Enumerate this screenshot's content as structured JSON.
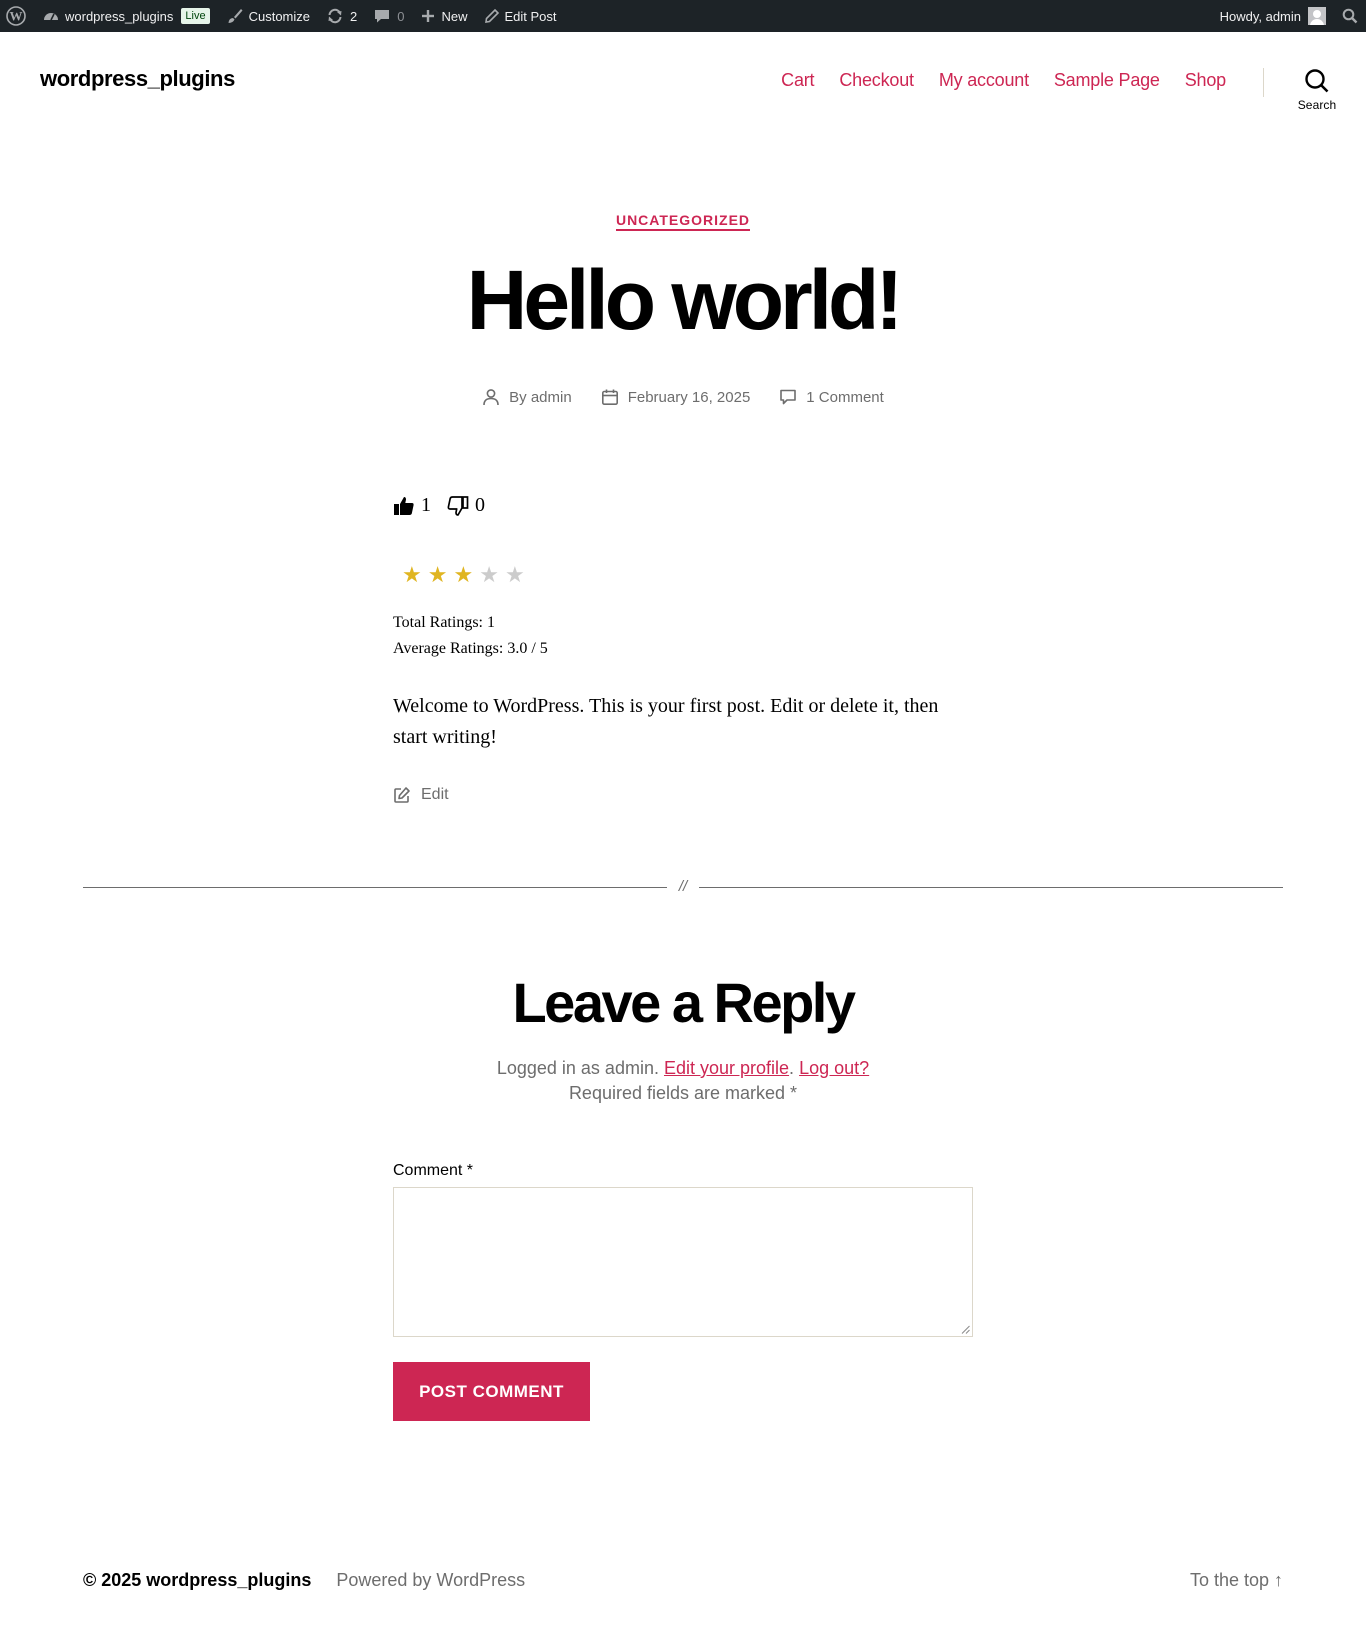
{
  "admin_bar": {
    "site_name": "wordpress_plugins",
    "live_badge": "Live",
    "customize": "Customize",
    "updates_count": "2",
    "comments_count": "0",
    "new_label": "New",
    "edit_post": "Edit Post",
    "howdy": "Howdy, admin"
  },
  "header": {
    "site_title": "wordpress_plugins",
    "nav": [
      "Cart",
      "Checkout",
      "My account",
      "Sample Page",
      "Shop"
    ],
    "search_label": "Search"
  },
  "post": {
    "category": "UNCATEGORIZED",
    "title": "Hello world!",
    "author": "By admin",
    "date": "February 16, 2025",
    "comments": "1 Comment",
    "likes": "1",
    "dislikes": "0",
    "rating": {
      "value": 3,
      "max": 5
    },
    "total_ratings": "Total Ratings: 1",
    "average_ratings": "Average Ratings: 3.0 / 5",
    "body": "Welcome to WordPress. This is your first post. Edit or delete it, then start writing!",
    "edit_label": "Edit",
    "separator": "//"
  },
  "reply": {
    "title": "Leave a Reply",
    "logged_in_prefix": "Logged in as admin.",
    "edit_profile": "Edit your profile",
    "log_out": "Log out?",
    "required": "Required fields are marked *",
    "comment_label": "Comment *",
    "comment_value": "",
    "submit": "POST COMMENT"
  },
  "footer": {
    "copyright": "© 2025 wordpress_plugins",
    "powered_by": "Powered by WordPress",
    "to_top": "To the top ↑"
  },
  "colors": {
    "accent": "#cd2653",
    "admin_bar_bg": "#1d2327",
    "star_filled": "#e0b521",
    "star_empty": "#cccccc",
    "meta_text": "#6d6d6d"
  },
  "icons": [
    "wordpress-icon",
    "dashboard-icon",
    "brush-icon",
    "updates-icon",
    "comment-bubble-icon",
    "plus-icon",
    "pencil-icon",
    "admin-search-icon",
    "search-icon",
    "user-icon",
    "calendar-icon",
    "comment-icon",
    "thumbs-up-icon",
    "thumbs-down-icon",
    "star-icon",
    "edit-icon"
  ]
}
